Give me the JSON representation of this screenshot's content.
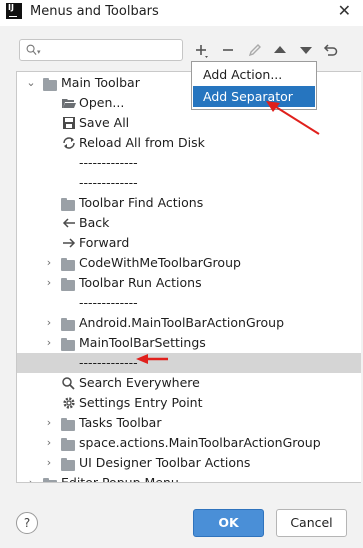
{
  "window": {
    "app_logo": "IJ",
    "title": "Menus and Toolbars",
    "close": "✕"
  },
  "toolbar": {
    "search_placeholder": "",
    "icons": [
      "add-icon",
      "remove-icon",
      "edit-icon",
      "move-up-icon",
      "move-down-icon",
      "restore-icon"
    ]
  },
  "popup": {
    "items": [
      "Add Action...",
      "Add Separator"
    ],
    "active_index": 1
  },
  "tree": {
    "rows": [
      {
        "label": "Main Toolbar",
        "icon": "folder",
        "level": 0,
        "expander": "open"
      },
      {
        "label": "Open...",
        "icon": "open-folder",
        "level": 1
      },
      {
        "label": "Save All",
        "icon": "save",
        "level": 1
      },
      {
        "label": "Reload All from Disk",
        "icon": "reload",
        "level": 1
      },
      {
        "label": "-------------",
        "icon": "",
        "level": 1
      },
      {
        "label": "-------------",
        "icon": "",
        "level": 1
      },
      {
        "label": "Toolbar Find Actions",
        "icon": "folder",
        "level": 1
      },
      {
        "label": "Back",
        "icon": "back-arrow",
        "level": 1
      },
      {
        "label": "Forward",
        "icon": "forward-arrow",
        "level": 1
      },
      {
        "label": "CodeWithMeToolbarGroup",
        "icon": "folder",
        "level": 1,
        "expander": "closed"
      },
      {
        "label": "Toolbar Run Actions",
        "icon": "folder",
        "level": 1,
        "expander": "closed"
      },
      {
        "label": "-------------",
        "icon": "",
        "level": 1
      },
      {
        "label": "Android.MainToolBarActionGroup",
        "icon": "folder",
        "level": 1,
        "expander": "closed"
      },
      {
        "label": "MainToolBarSettings",
        "icon": "folder",
        "level": 1,
        "expander": "closed"
      },
      {
        "label": "-------------",
        "icon": "",
        "level": 1,
        "selected": true
      },
      {
        "label": "Search Everywhere",
        "icon": "search",
        "level": 1
      },
      {
        "label": "Settings Entry Point",
        "icon": "gear",
        "level": 1
      },
      {
        "label": "Tasks Toolbar",
        "icon": "folder",
        "level": 1,
        "expander": "closed"
      },
      {
        "label": "space.actions.MainToolbarActionGroup",
        "icon": "folder",
        "level": 1,
        "expander": "closed"
      },
      {
        "label": "UI Designer Toolbar Actions",
        "icon": "folder",
        "level": 1,
        "expander": "closed"
      },
      {
        "label": "Editor Popup Menu",
        "icon": "folder",
        "level": 0,
        "expander": "closed"
      }
    ]
  },
  "buttons": {
    "help": "?",
    "ok": "OK",
    "cancel": "Cancel"
  },
  "colors": {
    "accent": "#2675bf",
    "ok_button": "#4a8fd7",
    "annotation_arrow": "#e0201c",
    "selection": "#d5d5d5"
  }
}
